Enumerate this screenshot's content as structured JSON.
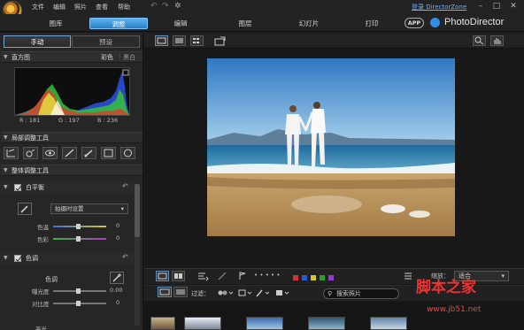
{
  "menu": [
    "文件",
    "编辑",
    "照片",
    "查看",
    "帮助"
  ],
  "login_text": "登录 DirectorZone",
  "modes": [
    "图库",
    "调整",
    "编辑",
    "图层",
    "幻灯片",
    "打印"
  ],
  "app_badge": "APP",
  "app_name": "PhotoDirector",
  "left": {
    "tabs": [
      "手动",
      "预设"
    ],
    "histogram": {
      "title": "直方图",
      "color_label": "彩色",
      "bw_label": "黑白",
      "r": "R : 181",
      "g": "G : 197",
      "b": "B : 236"
    },
    "local_tools_title": "局部调整工具",
    "global_tools_title": "整体调整工具",
    "white_balance": {
      "title": "白平衡",
      "preset": "拍摄时设置",
      "sliders": [
        {
          "label": "色温",
          "value": "0"
        },
        {
          "label": "色彩",
          "value": "0"
        }
      ]
    },
    "tone": {
      "title": "色调",
      "sub_label": "色调",
      "sliders": [
        {
          "label": "曝光度",
          "value": "0.00"
        },
        {
          "label": "对比度",
          "value": "0"
        }
      ],
      "next_label": "高光"
    }
  },
  "toolbar": {
    "filter_label": "过滤：",
    "search_placeholder": "搜索照片",
    "zoom_label": "缩放：",
    "zoom_value": "适合",
    "rating_dots": "• • • • •"
  },
  "colors": {
    "accent": "#2a7fc4",
    "labels": [
      "#d93030",
      "#2a58d6",
      "#d6c829",
      "#2c9a32",
      "#9a3bd0"
    ]
  },
  "watermark": {
    "site": "脚本之家",
    "url": "www.jb51.net"
  }
}
